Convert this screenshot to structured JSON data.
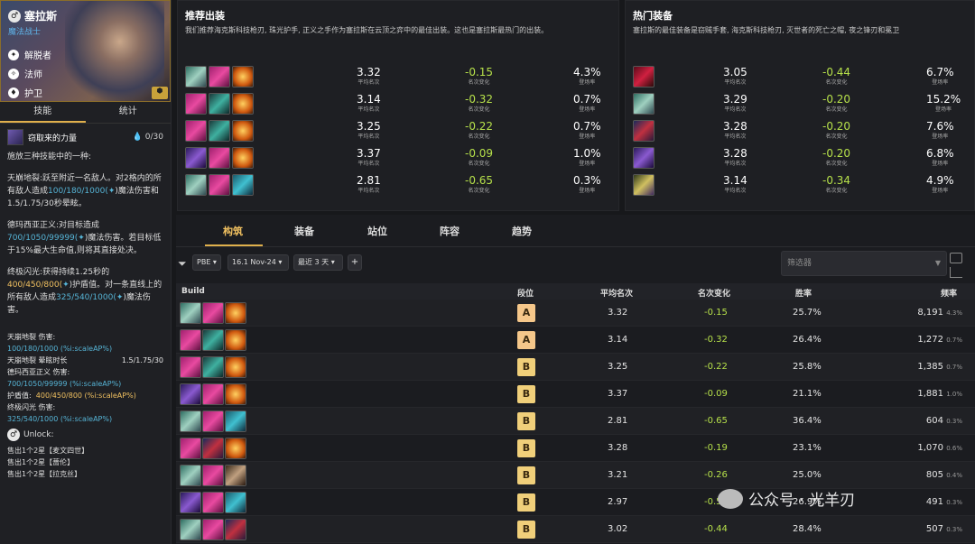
{
  "champion": {
    "name": "塞拉斯",
    "role": "魔法战士",
    "traits": [
      "解脱者",
      "法师",
      "护卫"
    ]
  },
  "left_tabs": [
    "技能",
    "统计"
  ],
  "skill": {
    "name": "窃取来的力量",
    "mana": "0/30"
  },
  "desc": {
    "p1": "施放三种技能中的一种:",
    "p2a": "天崩地裂:跃至附近一名敌人。对2格内的所有敌人造成",
    "p2b": "100/180/1000(",
    "p2c": ")魔法伤害和1.5/1.75/30秒晕眩。",
    "p3a": "德玛西亚正义:对目标造成",
    "p3b": "700/1050/99999(",
    "p3c": ")魔法伤害。若目标低于15%最大生命值,则将其直接处决。",
    "p4a": "终极闪光:获得持续1.25秒的",
    "p4b": "400/450/800(",
    "p4c": ")护盾值。对一条直线上的所有敌人造成",
    "p4d": "325/540/1000(",
    "p4e": ")魔法伤害。"
  },
  "stats": {
    "s1": "天崩地裂 伤害:",
    "s1v": "100/180/1000 (%i:scaleAP%)",
    "s2": "天崩地裂 晕眩时长",
    "s2v": "1.5/1.75/30",
    "s3": "德玛西亚正义 伤害:",
    "s3v": "700/1050/99999 (%i:scaleAP%)",
    "s4": "护盾值:",
    "s4v": "400/450/800 (%i:scaleAP%)",
    "s5": "终极闪光 伤害:",
    "s5v": "325/540/1000 (%i:scaleAP%)"
  },
  "unlock": {
    "label": "Unlock:",
    "lines": [
      "售出1个2星【麦文四世】",
      "售出1个2星【蔷伦】",
      "售出1个2星【拉克丝】"
    ]
  },
  "recommended": {
    "title": "推荐出装",
    "desc": "我们推荐海克斯科技枪刃, 珠光护手, 正义之手作为塞拉斯在云顶之弈中的最佳出装。这也是塞拉斯最热门的出装。",
    "labels": {
      "avg": "平均名次",
      "chg": "名次变化",
      "pick": "登场率"
    },
    "rows": [
      {
        "avg": "3.32",
        "chg": "-0.15",
        "pick": "4.3%"
      },
      {
        "avg": "3.14",
        "chg": "-0.32",
        "pick": "0.7%"
      },
      {
        "avg": "3.25",
        "chg": "-0.22",
        "pick": "0.7%"
      },
      {
        "avg": "3.37",
        "chg": "-0.09",
        "pick": "1.0%"
      },
      {
        "avg": "2.81",
        "chg": "-0.65",
        "pick": "0.3%"
      }
    ]
  },
  "popular": {
    "title": "热门装备",
    "desc": "塞拉斯的最佳装备是窃贼手套, 海克斯科技枪刃, 灭世者的死亡之帽, 夜之锋刃和冕卫",
    "rows": [
      {
        "avg": "3.05",
        "chg": "-0.44",
        "pick": "6.7%"
      },
      {
        "avg": "3.29",
        "chg": "-0.20",
        "pick": "15.2%"
      },
      {
        "avg": "3.28",
        "chg": "-0.20",
        "pick": "7.6%"
      },
      {
        "avg": "3.28",
        "chg": "-0.20",
        "pick": "6.8%"
      },
      {
        "avg": "3.14",
        "chg": "-0.34",
        "pick": "4.9%"
      }
    ]
  },
  "main_tabs": [
    "构筑",
    "装备",
    "站位",
    "阵容",
    "趋势"
  ],
  "filters": {
    "patch_env": "PBE",
    "patch": "16.1 Nov-24",
    "period": "最近 3 天",
    "search_placeholder": "筛选器"
  },
  "table": {
    "headers": {
      "build": "Build",
      "tier": "段位",
      "avg": "平均名次",
      "chg": "名次变化",
      "win": "胜率",
      "freq": "频率"
    },
    "rows": [
      {
        "tier": "A",
        "avg": "3.32",
        "chg": "-0.15",
        "win": "25.7%",
        "freq": "8,191",
        "fp": "4.3%"
      },
      {
        "tier": "A",
        "avg": "3.14",
        "chg": "-0.32",
        "win": "26.4%",
        "freq": "1,272",
        "fp": "0.7%"
      },
      {
        "tier": "B",
        "avg": "3.25",
        "chg": "-0.22",
        "win": "25.8%",
        "freq": "1,385",
        "fp": "0.7%"
      },
      {
        "tier": "B",
        "avg": "3.37",
        "chg": "-0.09",
        "win": "21.1%",
        "freq": "1,881",
        "fp": "1.0%"
      },
      {
        "tier": "B",
        "avg": "2.81",
        "chg": "-0.65",
        "win": "36.4%",
        "freq": "604",
        "fp": "0.3%"
      },
      {
        "tier": "B",
        "avg": "3.28",
        "chg": "-0.19",
        "win": "23.1%",
        "freq": "1,070",
        "fp": "0.6%"
      },
      {
        "tier": "B",
        "avg": "3.21",
        "chg": "-0.26",
        "win": "25.0%",
        "freq": "805",
        "fp": "0.4%"
      },
      {
        "tier": "B",
        "avg": "2.97",
        "chg": "-0.50",
        "win": "26.9%",
        "freq": "491",
        "fp": "0.3%"
      },
      {
        "tier": "B",
        "avg": "3.02",
        "chg": "-0.44",
        "win": "28.4%",
        "freq": "507",
        "fp": "0.3%"
      }
    ]
  },
  "watermark": "公众号 · 光羊刃",
  "colors": {
    "accent": "#e0b04c",
    "positive_change": "#b6e04a",
    "cyan_text": "#56b4d6"
  }
}
